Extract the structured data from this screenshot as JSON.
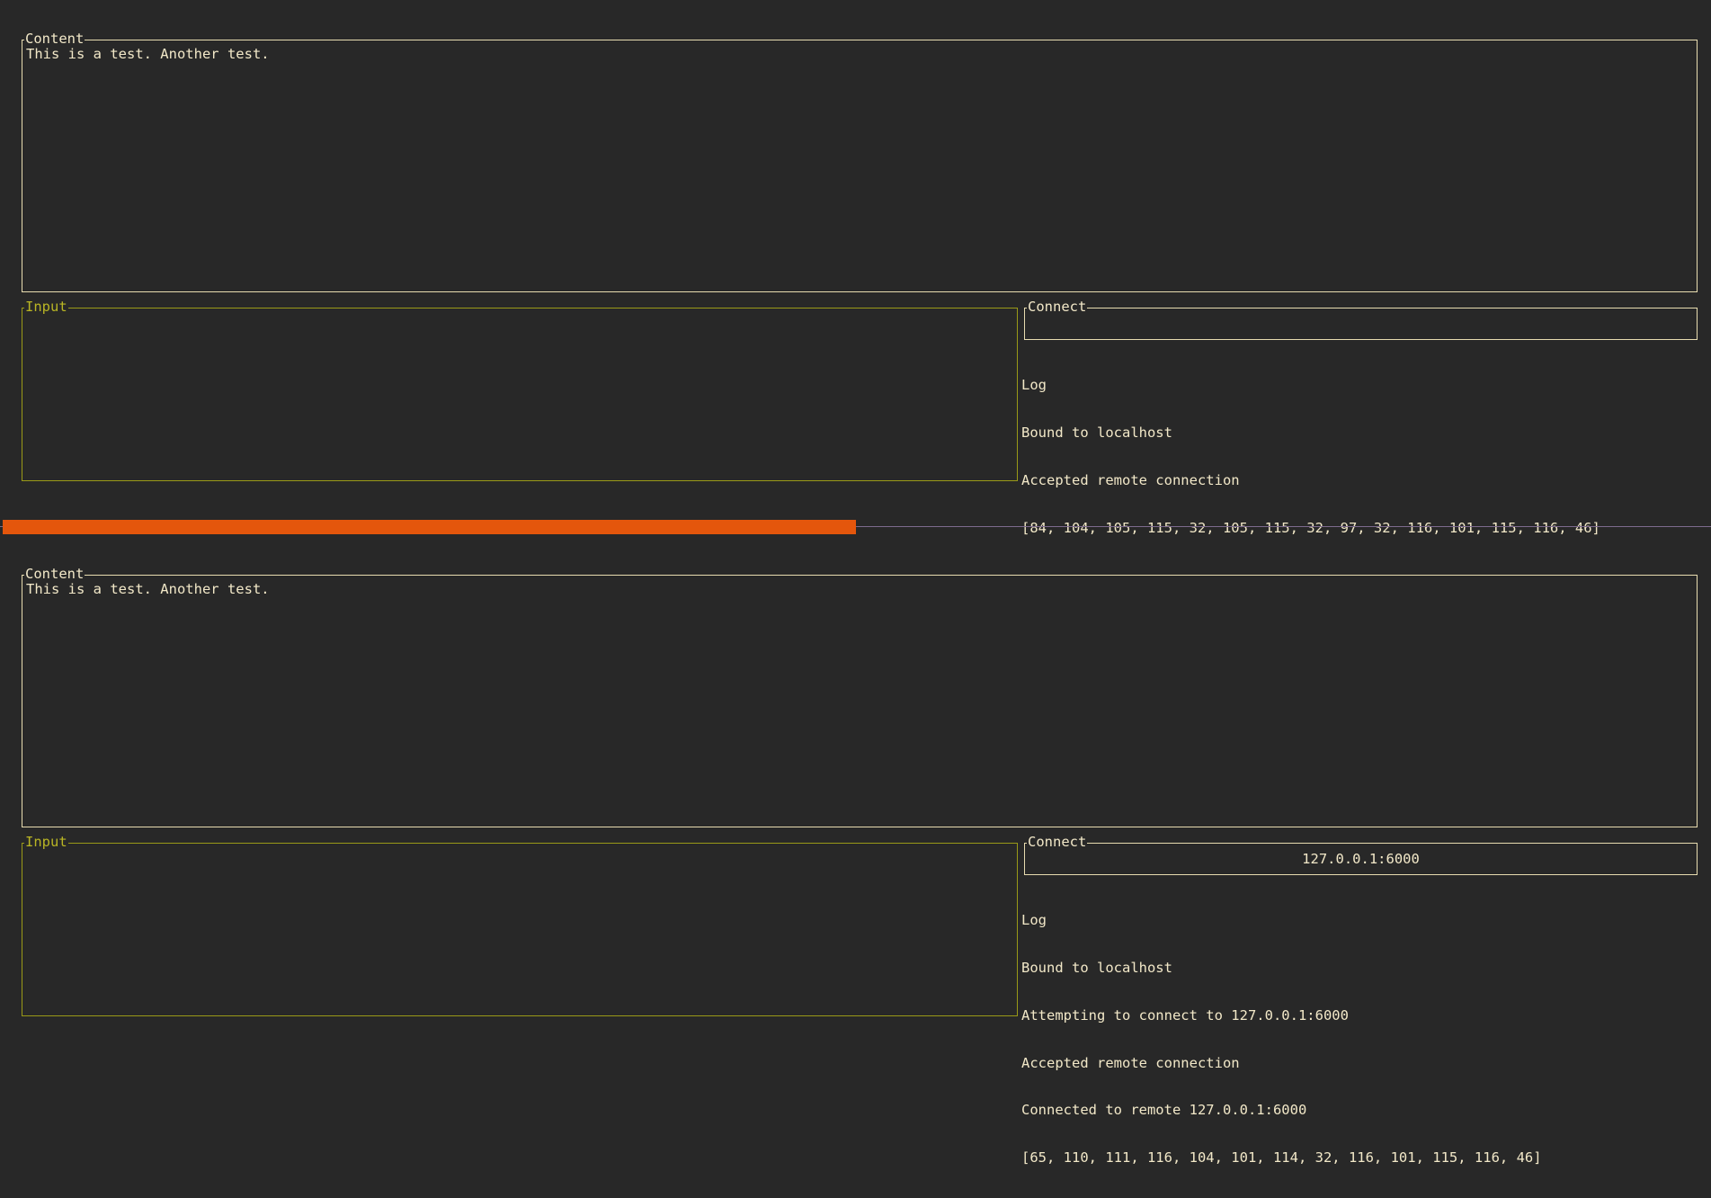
{
  "panes": [
    {
      "content": {
        "title": "Content",
        "text": "This is a test. Another test."
      },
      "input": {
        "title": "Input",
        "value": ""
      },
      "connect": {
        "title": "Connect",
        "value": ""
      },
      "log": {
        "title": "Log",
        "lines": [
          "Bound to localhost",
          "Accepted remote connection",
          "[84, 104, 105, 115, 32, 105, 115, 32, 97, 32, 116, 101, 115, 116, 46]"
        ]
      }
    },
    {
      "content": {
        "title": "Content",
        "text": "This is a test. Another test."
      },
      "input": {
        "title": "Input",
        "value": ""
      },
      "connect": {
        "title": "Connect",
        "value": "127.0.0.1:6000"
      },
      "log": {
        "title": "Log",
        "lines": [
          "Bound to localhost",
          "Attempting to connect to 127.0.0.1:6000",
          "Accepted remote connection",
          "Connected to remote 127.0.0.1:6000",
          "[65, 110, 111, 116, 104, 101, 114, 32, 116, 101, 115, 116, 46]"
        ]
      }
    }
  ],
  "divider": {
    "split_fraction": 0.5
  },
  "colors": {
    "background": "#282828",
    "text": "#f2e8c8",
    "content_border": "#e8dcb0",
    "input_border": "#9a9a18",
    "input_title": "#b9b524",
    "divider_handle": "#e4560c",
    "divider_line": "#7d6b8e"
  }
}
